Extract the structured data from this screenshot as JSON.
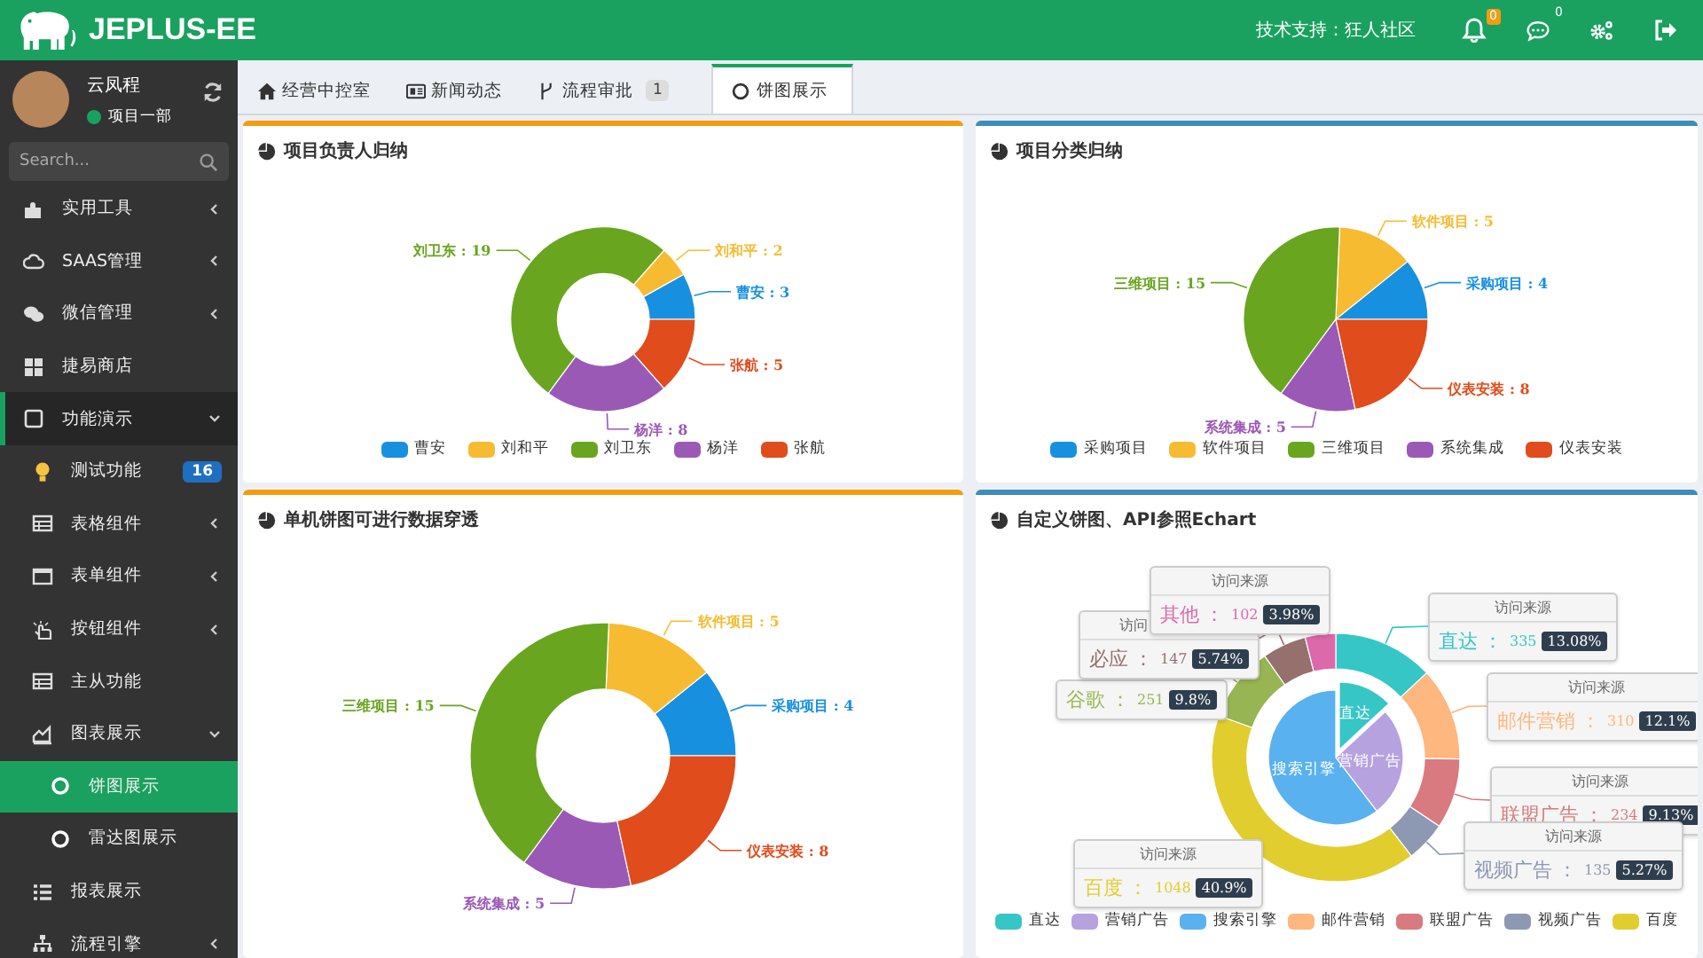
{
  "header": {
    "logo_text": "JEPLUS-EE",
    "support_text": "技术支持：狂人社区",
    "notification_badge": "0",
    "message_badge": "0"
  },
  "sidebar": {
    "user": {
      "name": "云凤程",
      "status": "项目一部",
      "online": true
    },
    "search": {
      "placeholder": "Search..."
    },
    "menu": [
      {
        "label": "实用工具",
        "expanded": false,
        "selected": false
      },
      {
        "label": "SAAS管理",
        "expanded": false,
        "selected": false
      },
      {
        "label": "微信管理",
        "expanded": false,
        "selected": false
      },
      {
        "label": "捷易商店",
        "selected": false
      },
      {
        "label": "功能演示",
        "expanded": true,
        "selected": false,
        "children": [
          {
            "label": "测试功能",
            "badge": "16",
            "selected": false
          },
          {
            "label": "表格组件",
            "expanded": false,
            "selected": false
          },
          {
            "label": "表单组件",
            "expanded": false,
            "selected": false
          },
          {
            "label": "按钮组件",
            "expanded": false,
            "selected": false
          },
          {
            "label": "主从功能",
            "selected": false
          },
          {
            "label": "图表展示",
            "expanded": true,
            "selected": false,
            "children": [
              {
                "label": "饼图展示",
                "selected": true
              },
              {
                "label": "雷达图展示",
                "selected": false
              }
            ]
          },
          {
            "label": "报表展示",
            "selected": false
          },
          {
            "label": "流程引擎",
            "expanded": false,
            "selected": false
          }
        ]
      }
    ]
  },
  "tabs": [
    {
      "label": "经营中控室",
      "selected": false
    },
    {
      "label": "新闻动态",
      "selected": false
    },
    {
      "label": "流程审批",
      "badge": "1",
      "selected": false
    },
    {
      "label": "饼图展示",
      "selected": true
    }
  ],
  "panels": [
    {
      "kind": "simple",
      "title": "项目负责人归纳",
      "color": "#f39c12",
      "chart_data": {
        "type": "donut",
        "categories": [
          "曹安",
          "刘和平",
          "刘卫东",
          "杨洋",
          "张航"
        ],
        "values": [
          3,
          2,
          19,
          8,
          5
        ],
        "value_labels": [
          "曹安 : 3",
          "刘和平 : 2",
          "刘卫东 : 19",
          "杨洋 : 8",
          "张航 : 5"
        ]
      },
      "slices": [
        {
          "color": "#1890e0"
        },
        {
          "color": "#f7bb32"
        },
        {
          "color": "#6aa51f"
        },
        {
          "color": "#9b59b6"
        },
        {
          "color": "#e04c1b"
        }
      ],
      "legend": [
        {
          "color": "#1890e0"
        },
        {
          "color": "#f7bb32"
        },
        {
          "color": "#6aa51f"
        },
        {
          "color": "#9b59b6"
        },
        {
          "color": "#e04c1b"
        }
      ]
    },
    {
      "kind": "simple",
      "title": "项目分类归纳",
      "color": "#3c8dbc",
      "chart_data": {
        "type": "pie",
        "categories": [
          "采购项目",
          "软件项目",
          "三维项目",
          "系统集成",
          "仪表安装"
        ],
        "values": [
          4,
          5,
          15,
          5,
          8
        ],
        "value_labels": [
          "采购项目 : 4",
          "软件项目 : 5",
          "三维项目 : 15",
          "系统集成 : 5",
          "仪表安装 : 8"
        ]
      },
      "slices": [
        {
          "color": "#1890e0"
        },
        {
          "color": "#f7bb32"
        },
        {
          "color": "#6aa51f"
        },
        {
          "color": "#9b59b6"
        },
        {
          "color": "#e04c1b"
        }
      ],
      "legend": [
        {
          "color": "#1890e0"
        },
        {
          "color": "#f7bb32"
        },
        {
          "color": "#6aa51f"
        },
        {
          "color": "#9b59b6"
        },
        {
          "color": "#e04c1b"
        }
      ]
    },
    {
      "kind": "simple",
      "title": "单机饼图可进行数据穿透",
      "color": "#f39c12",
      "chart_data": {
        "type": "donut",
        "values": [
          4,
          5,
          15,
          5,
          8
        ],
        "value_labels": [
          "采购项目 : 4",
          "软件项目 : 5",
          "三维项目 : 15",
          "系统集成 : 5",
          "仪表安装 : 8"
        ]
      },
      "slices": [
        {
          "color": "#1890e0"
        },
        {
          "color": "#f7bb32"
        },
        {
          "color": "#6aa51f"
        },
        {
          "color": "#9b59b6"
        },
        {
          "color": "#e04c1b"
        }
      ]
    },
    {
      "kind": "nested",
      "title": "自定义饼图、API参照Echart",
      "color": "#3c8dbc",
      "chart_data": {
        "type": "donut",
        "categories": [
          "直达",
          "邮件营销",
          "联盟广告",
          "视频广告",
          "百度",
          "谷歌",
          "必应",
          "其他"
        ],
        "values": [
          13.08,
          12.1,
          9.13,
          5.27,
          40.9,
          9.8,
          5.74,
          3.98
        ]
      },
      "slices": [
        {
          "color": "#36c6c6"
        },
        {
          "color": "#fdb77f"
        },
        {
          "color": "#d87a80"
        },
        {
          "color": "#8d98b3"
        },
        {
          "color": "#e2cd2e"
        },
        {
          "color": "#97b552"
        },
        {
          "color": "#95706d"
        },
        {
          "color": "#dc69aa"
        }
      ],
      "inner_chart": {
        "chart_data": {
          "type": "pie",
          "categories": [
            "直达",
            "营销广告",
            "搜索引擎"
          ],
          "values": [
            13.1,
            26.5,
            60.4
          ]
        },
        "slices": [
          {
            "color": "#36c6c6"
          },
          {
            "color": "#b6a2de"
          },
          {
            "color": "#5ab1ef"
          }
        ]
      },
      "tooltips": [
        {
          "title": "访问来源",
          "colon": "：",
          "value": "102",
          "percent": "3.98%"
        },
        {
          "title": "访问来源",
          "colon": "：",
          "value": "335",
          "percent": "13.08%"
        },
        {
          "title": "访问",
          "colon": "：",
          "value": "147",
          "percent": "5.74%"
        },
        {
          "colon": "：",
          "value": "251",
          "percent": "9.8%"
        },
        {
          "title": "访问来源",
          "colon": "：",
          "value": "310",
          "percent": "12.1%"
        },
        {
          "title": "访问来源",
          "colon": "：",
          "value": "234",
          "percent": "9.13%"
        },
        {
          "title": "访问来源",
          "colon": "：",
          "value": "135",
          "percent": "5.27%"
        },
        {
          "title": "访问来源",
          "colon": "：",
          "value": "1048",
          "percent": "40.9%"
        }
      ],
      "legend": [
        {
          "label": "直达",
          "color": "#36c6c6"
        },
        {
          "label": "营销广告",
          "color": "#b6a2de"
        },
        {
          "label": "搜索引擎",
          "color": "#5ab1ef"
        },
        {
          "label": "邮件营销",
          "color": "#fdb77f"
        },
        {
          "label": "联盟广告",
          "color": "#d87a80"
        },
        {
          "label": "视频广告",
          "color": "#8d98b3"
        },
        {
          "label": "百度",
          "color": "#e2cd2e"
        }
      ]
    }
  ]
}
